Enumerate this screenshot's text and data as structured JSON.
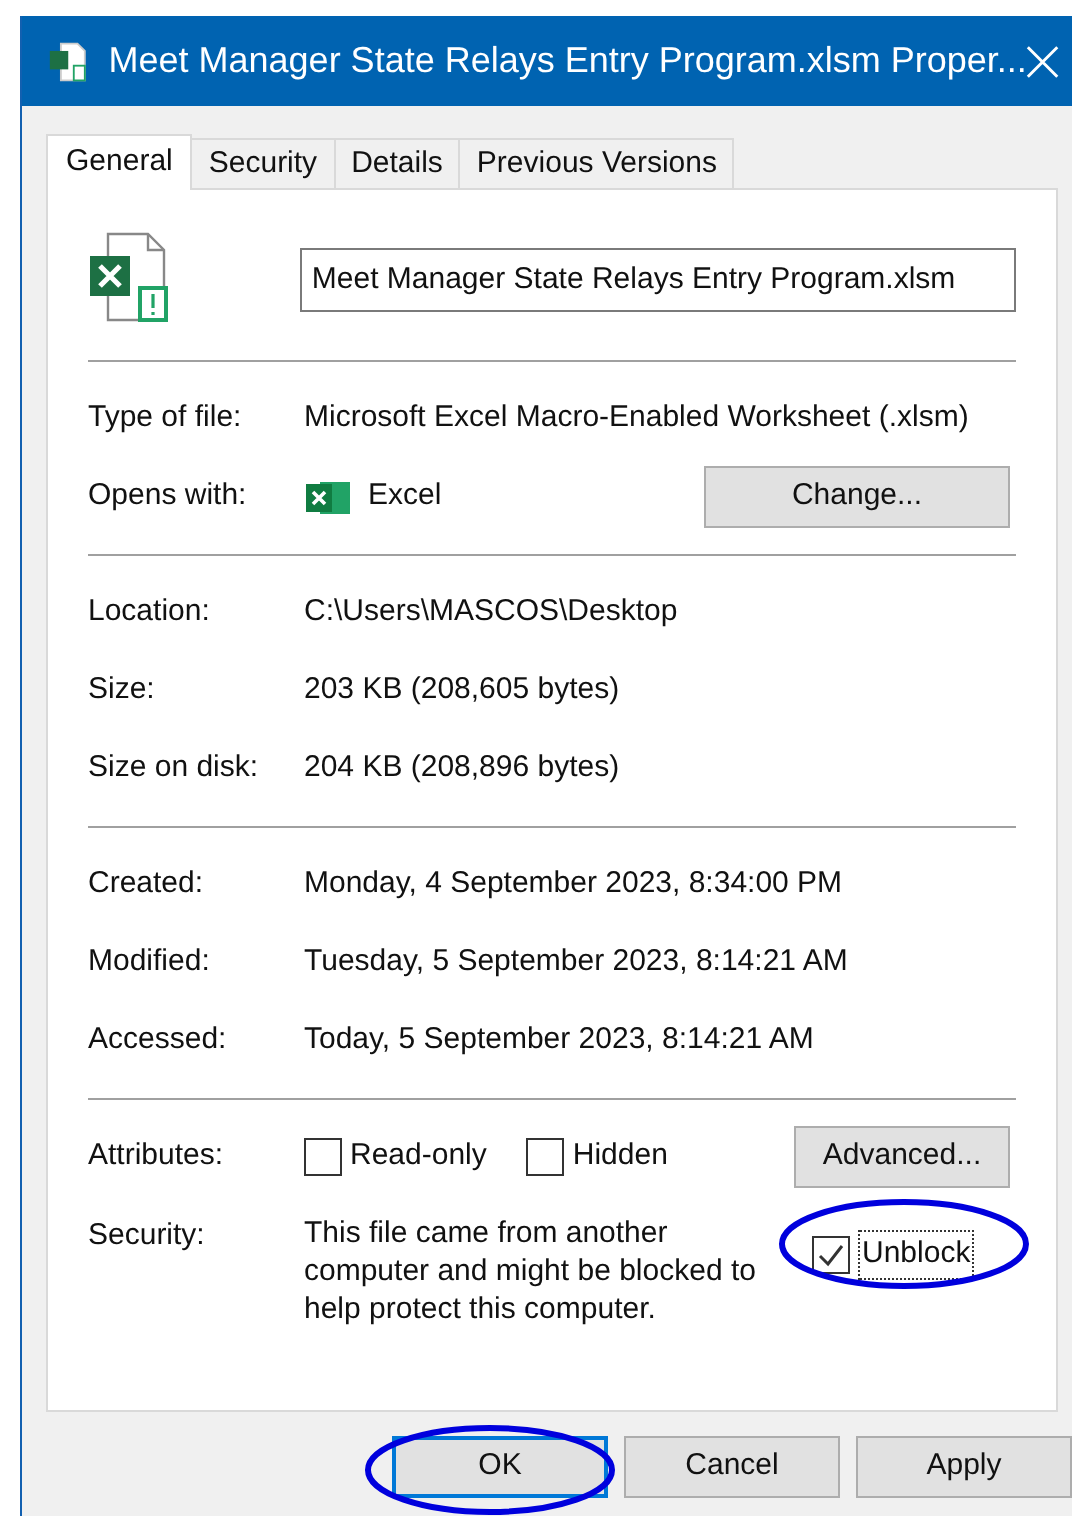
{
  "window": {
    "title": "Meet Manager State Relays Entry Program.xlsm Proper..."
  },
  "tabs": [
    {
      "label": "General",
      "selected": true
    },
    {
      "label": "Security",
      "selected": false
    },
    {
      "label": "Details",
      "selected": false
    },
    {
      "label": "Previous Versions",
      "selected": false
    }
  ],
  "file_name": {
    "value": "Meet Manager State Relays Entry Program.xlsm"
  },
  "type_of_file": {
    "label": "Type of file:",
    "value": "Microsoft Excel Macro-Enabled Worksheet (.xlsm)"
  },
  "opens_with": {
    "label": "Opens with:",
    "app": "Excel",
    "button": "Change..."
  },
  "location_section": [
    {
      "label": "Location:",
      "value": "C:\\Users\\MASCOS\\Desktop"
    },
    {
      "label": "Size:",
      "value": "203 KB (208,605 bytes)"
    },
    {
      "label": "Size on disk:",
      "value": "204 KB (208,896 bytes)"
    }
  ],
  "dates_section": [
    {
      "label": "Created:",
      "value": "Monday, 4 September 2023, 8:34:00 PM"
    },
    {
      "label": "Modified:",
      "value": "Tuesday, 5 September 2023, 8:14:21 AM"
    },
    {
      "label": "Accessed:",
      "value": "Today, 5 September 2023, 8:14:21 AM"
    }
  ],
  "attributes": {
    "label": "Attributes:",
    "checkboxes": [
      {
        "label": "Read-only",
        "checked": false
      },
      {
        "label": "Hidden",
        "checked": false
      }
    ],
    "button": "Advanced..."
  },
  "security": {
    "label": "Security:",
    "text": "This file came from another computer and might be blocked to help protect this computer.",
    "unblock": {
      "label": "Unblock",
      "checked": true
    }
  },
  "buttons": [
    {
      "label": "OK",
      "default": true
    },
    {
      "label": "Cancel",
      "default": false
    },
    {
      "label": "Apply",
      "default": false
    }
  ]
}
